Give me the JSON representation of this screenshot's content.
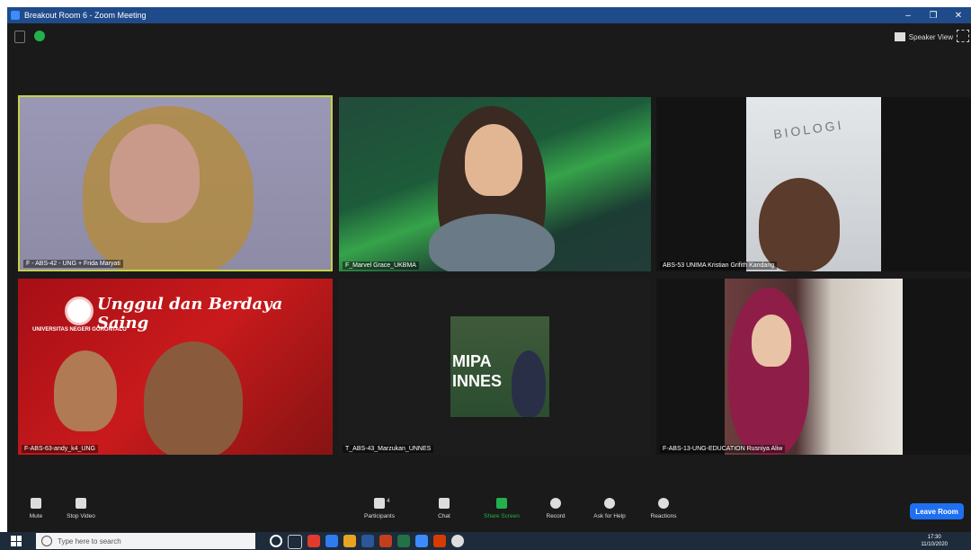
{
  "window": {
    "title": "Breakout Room 6 - Zoom Meeting"
  },
  "topbar": {
    "view_label": "Speaker View"
  },
  "tiles": [
    {
      "name": "F - ABS-42 - UNG + Frida Maryati"
    },
    {
      "name": "F_Marvel Grace_UKBMA"
    },
    {
      "name": "ABS-53 UNIMA Kristian Grifith Kandang"
    },
    {
      "name": "F-ABS-63-andy_k4_UNG"
    },
    {
      "name": "T_ABS-43_Marzukan_UNNES"
    },
    {
      "name": "F-ABS-13-UNG-EDUCATION Rusniya Aliw"
    }
  ],
  "tile4": {
    "motto": "Unggul dan Berdaya Saing",
    "university": "UNIVERSITAS NEGERI GORONTALO"
  },
  "tile5": {
    "line1": "MIPA",
    "line2": "INNES"
  },
  "tile3": {
    "wall_text": "BIOLOGI"
  },
  "toolbar": {
    "mute": "Mute",
    "stop_video": "Stop Video",
    "participants": "Participants",
    "participants_count": "4",
    "chat": "Chat",
    "share": "Share Screen",
    "record": "Record",
    "ask_help": "Ask for Help",
    "reactions": "Reactions",
    "leave": "Leave Room"
  },
  "taskbar": {
    "search_placeholder": "Type here to search",
    "time": "17:30",
    "date": "11/10/2020"
  },
  "colors": {
    "accent": "#1e6ff2",
    "active_border": "#c7d147",
    "share_green": "#22b14c"
  }
}
